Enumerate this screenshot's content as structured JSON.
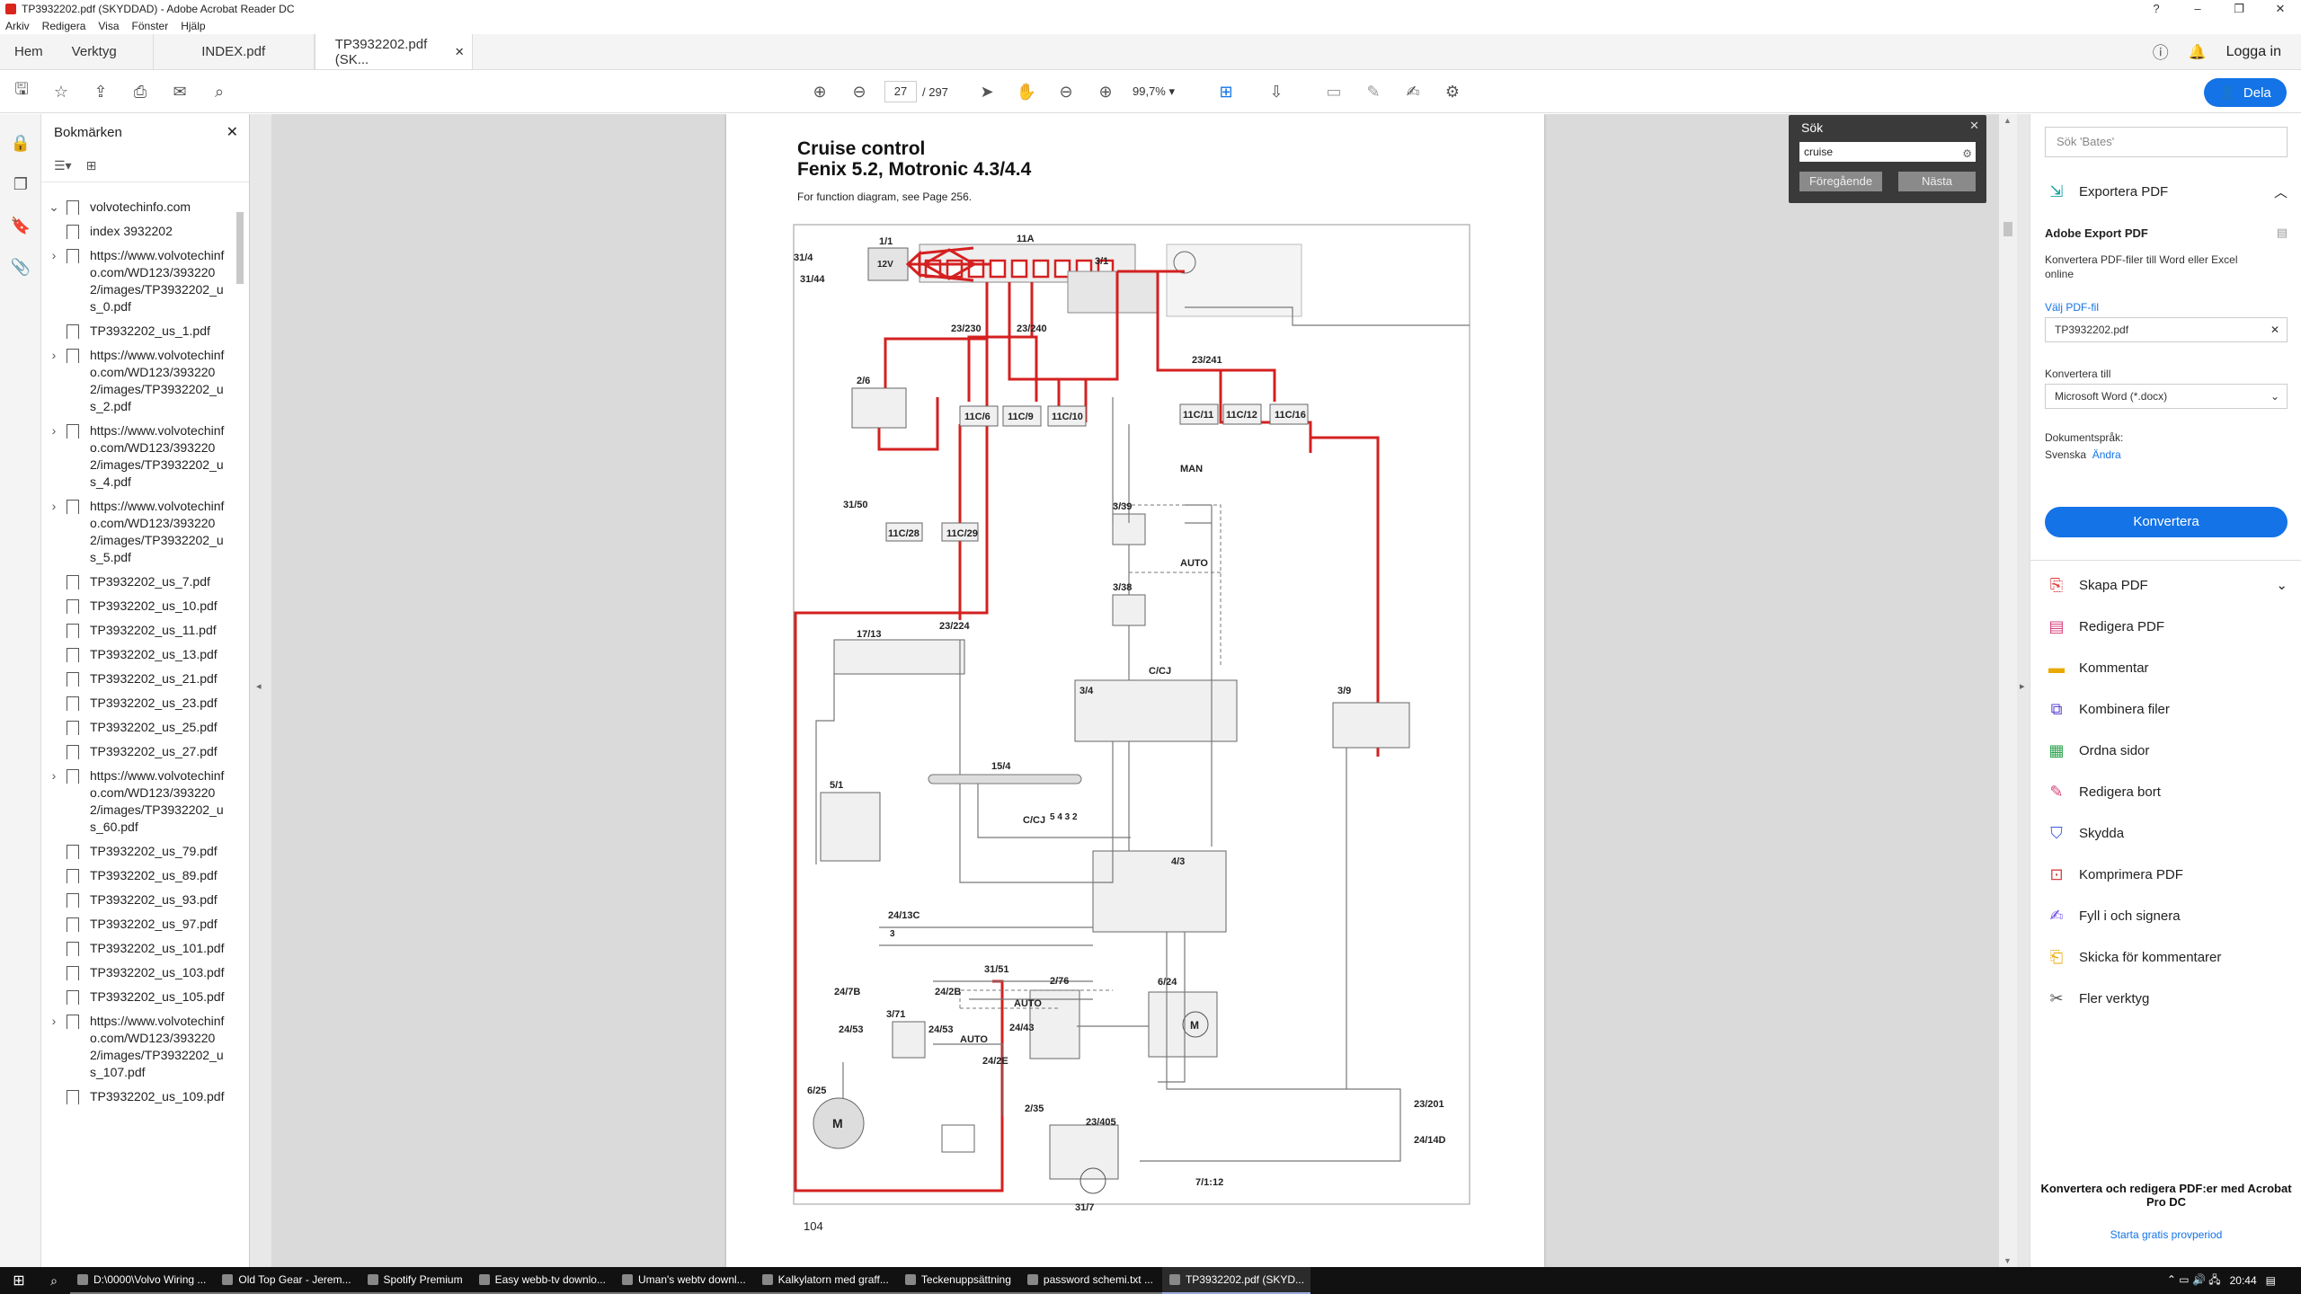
{
  "window": {
    "title": "TP3932202.pdf (SKYDDAD) - Adobe Acrobat Reader DC",
    "controls": [
      "?",
      "–",
      "❐",
      "✕"
    ]
  },
  "menu": [
    "Arkiv",
    "Redigera",
    "Visa",
    "Fönster",
    "Hjälp"
  ],
  "tabs": {
    "home": "Hem",
    "tools": "Verktyg",
    "docs": [
      {
        "label": "INDEX.pdf",
        "active": false
      },
      {
        "label": "TP3932202.pdf (SK...",
        "active": true
      }
    ],
    "login": "Logga in"
  },
  "toolbar": {
    "page_current": "27",
    "page_total": "/ 297",
    "zoom": "99,7%",
    "share_label": "Dela"
  },
  "bookmarks": {
    "title": "Bokmärken",
    "items": [
      {
        "label": "volvotechinfo.com",
        "expand": "⌄"
      },
      {
        "label": "index 3932202",
        "expand": ""
      },
      {
        "label": "https://www.volvotechinfo.com/WD123/3932202/images/TP3932202_us_0.pdf",
        "expand": "›"
      },
      {
        "label": "TP3932202_us_1.pdf",
        "expand": ""
      },
      {
        "label": "https://www.volvotechinfo.com/WD123/3932202/images/TP3932202_us_2.pdf",
        "expand": "›"
      },
      {
        "label": "https://www.volvotechinfo.com/WD123/3932202/images/TP3932202_us_4.pdf",
        "expand": "›"
      },
      {
        "label": "https://www.volvotechinfo.com/WD123/3932202/images/TP3932202_us_5.pdf",
        "expand": "›"
      },
      {
        "label": "TP3932202_us_7.pdf",
        "expand": ""
      },
      {
        "label": "TP3932202_us_10.pdf",
        "expand": ""
      },
      {
        "label": "TP3932202_us_11.pdf",
        "expand": ""
      },
      {
        "label": "TP3932202_us_13.pdf",
        "expand": ""
      },
      {
        "label": "TP3932202_us_21.pdf",
        "expand": ""
      },
      {
        "label": "TP3932202_us_23.pdf",
        "expand": ""
      },
      {
        "label": "TP3932202_us_25.pdf",
        "expand": ""
      },
      {
        "label": "TP3932202_us_27.pdf",
        "expand": ""
      },
      {
        "label": "https://www.volvotechinfo.com/WD123/3932202/images/TP3932202_us_60.pdf",
        "expand": "›"
      },
      {
        "label": "TP3932202_us_79.pdf",
        "expand": ""
      },
      {
        "label": "TP3932202_us_89.pdf",
        "expand": ""
      },
      {
        "label": "TP3932202_us_93.pdf",
        "expand": ""
      },
      {
        "label": "TP3932202_us_97.pdf",
        "expand": ""
      },
      {
        "label": "TP3932202_us_101.pdf",
        "expand": ""
      },
      {
        "label": "TP3932202_us_103.pdf",
        "expand": ""
      },
      {
        "label": "TP3932202_us_105.pdf",
        "expand": ""
      },
      {
        "label": "https://www.volvotechinfo.com/WD123/3932202/images/TP3932202_us_107.pdf",
        "expand": "›"
      },
      {
        "label": "TP3932202_us_109.pdf",
        "expand": ""
      }
    ]
  },
  "document": {
    "title_line1": "Cruise control",
    "title_line2": "Fenix 5.2, Motronic 4.3/4.4",
    "subtitle": "For function diagram, see Page 256.",
    "page_number": "104",
    "labels": {
      "l_31_4": "31/4",
      "l_31_44": "31/44",
      "l_1_1": "1/1",
      "l_12v": "12V",
      "l_11a": "11A",
      "l_3_1": "3/1",
      "l_23_230": "23/230",
      "l_23_240": "23/240",
      "l_23_241": "23/241",
      "l_2_6": "2/6",
      "l_11c6": "11C/6",
      "l_11c9": "11C/9",
      "l_11c10": "11C/10",
      "l_11c11": "11C/11",
      "l_11c12": "11C/12",
      "l_11c16": "11C/16",
      "l_31_50": "31/50",
      "l_11c28": "11C/28",
      "l_11c29": "11C/29",
      "l_man": "MAN",
      "l_3_39": "3/39",
      "l_auto1": "AUTO",
      "l_3_38": "3/38",
      "l_23_224": "23/224",
      "l_17_13": "17/13",
      "l_ccj": "C/CJ",
      "l_3_4": "3/4",
      "l_3_9": "3/9",
      "l_15_4": "15/4",
      "l_5_1": "5/1",
      "l_ccj2": "C/CJ",
      "l_4_3": "4/3",
      "l_24_13c": "24/13C",
      "l_31_51": "31/51",
      "l_24_7b": "24/7B",
      "l_24_2b": "24/2B",
      "l_auto2": "AUTO",
      "l_6_24": "6/24",
      "l_3_71": "3/71",
      "l_24_53a": "24/53",
      "l_24_53b": "24/53",
      "l_auto3": "AUTO",
      "l_24_43": "24/43",
      "l_2_76": "2/76",
      "l_24_2e": "24/2E",
      "l_6_25": "6/25",
      "l_2_35": "2/35",
      "l_23_405": "23/405",
      "l_23_201": "23/201",
      "l_24_14d": "24/14D",
      "l_31_7": "31/7",
      "l_7_1_12": "7/1:12"
    }
  },
  "search": {
    "title": "Sök",
    "value": "cruise",
    "prev_label": "Föregående",
    "next_label": "Nästa"
  },
  "right_panel": {
    "bates_placeholder": "Sök 'Bates'",
    "export_label": "Exportera PDF",
    "export_title": "Adobe Export PDF",
    "export_desc": "Konvertera PDF-filer till Word eller Excel online",
    "choose_file": "Välj PDF-fil",
    "file_name": "TP3932202.pdf",
    "convert_to_label": "Konvertera till",
    "convert_to_value": "Microsoft Word (*.docx)",
    "doc_lang_label": "Dokumentspråk:",
    "doc_lang_value": "Svenska",
    "change_link": "Ändra",
    "convert_button": "Konvertera",
    "tools": [
      {
        "label": "Skapa PDF",
        "icon": "create-pdf-icon",
        "glyph": "⎘",
        "color": "#e03c3c"
      },
      {
        "label": "Redigera PDF",
        "icon": "edit-pdf-icon",
        "glyph": "▤",
        "color": "#d8407a"
      },
      {
        "label": "Kommentar",
        "icon": "comment-icon",
        "glyph": "▬",
        "color": "#e8a900"
      },
      {
        "label": "Kombinera filer",
        "icon": "combine-icon",
        "glyph": "⧉",
        "color": "#5a3fd0"
      },
      {
        "label": "Ordna sidor",
        "icon": "organize-pages-icon",
        "glyph": "▦",
        "color": "#2ea44f"
      },
      {
        "label": "Redigera bort",
        "icon": "redact-icon",
        "glyph": "✎",
        "color": "#d8407a"
      },
      {
        "label": "Skydda",
        "icon": "protect-icon",
        "glyph": "⛉",
        "color": "#3b5bdb"
      },
      {
        "label": "Komprimera PDF",
        "icon": "compress-icon",
        "glyph": "⊡",
        "color": "#d84040"
      },
      {
        "label": "Fyll i och signera",
        "icon": "fill-sign-icon",
        "glyph": "✍",
        "color": "#7048e8"
      },
      {
        "label": "Skicka för kommentarer",
        "icon": "send-comments-icon",
        "glyph": "⎗",
        "color": "#e8a900"
      },
      {
        "label": "Fler verktyg",
        "icon": "more-tools-icon",
        "glyph": "✂",
        "color": "#555"
      }
    ],
    "promo": "Konvertera och redigera PDF:er med Acrobat Pro DC",
    "promo_link": "Starta gratis provperiod"
  },
  "taskbar": {
    "items": [
      {
        "label": "D:\\0000\\Volvo Wiring ...",
        "active": false
      },
      {
        "label": "Old Top Gear - Jerem...",
        "active": false
      },
      {
        "label": "Spotify Premium",
        "active": false
      },
      {
        "label": "Easy webb-tv downlo...",
        "active": false
      },
      {
        "label": "Uman's webtv downl...",
        "active": false
      },
      {
        "label": "Kalkylatorn med graff...",
        "active": false
      },
      {
        "label": "Teckenuppsättning",
        "active": false
      },
      {
        "label": "password schemi.txt ...",
        "active": false
      },
      {
        "label": "TP3932202.pdf (SKYD...",
        "active": true
      }
    ],
    "time": "20:44"
  },
  "colors": {
    "accent": "#1473e6",
    "wire_red": "#d42020"
  }
}
